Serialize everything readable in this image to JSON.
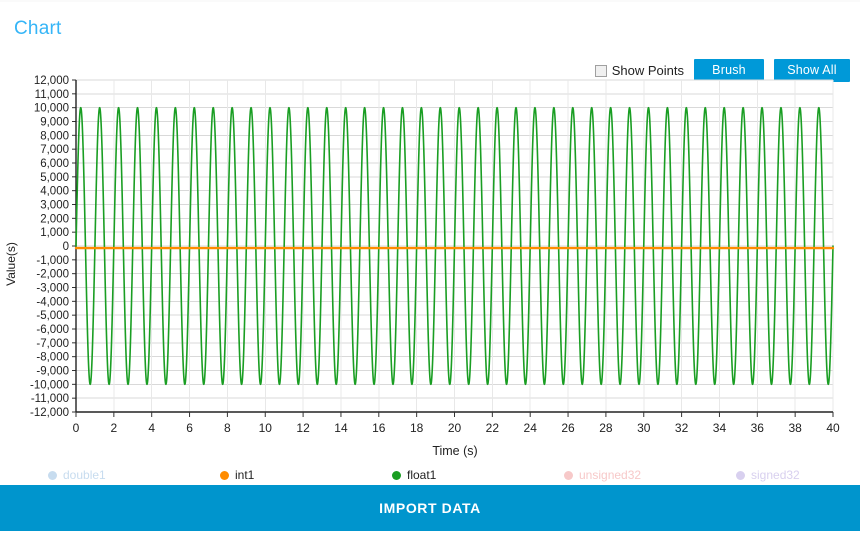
{
  "header": {
    "title": "Chart"
  },
  "toolbar": {
    "show_points_label": "Show Points",
    "show_points_checked": false,
    "brush_label": "Brush",
    "show_all_label": "Show All",
    "accent_color": "#0099d8"
  },
  "footer": {
    "import_label": "IMPORT DATA",
    "import_color": "#0095cd"
  },
  "legend": [
    {
      "label": "double1",
      "color": "#c7dcef",
      "active": false
    },
    {
      "label": "int1",
      "color": "#ff8c00",
      "active": true
    },
    {
      "label": "float1",
      "color": "#1a9e23",
      "active": true
    },
    {
      "label": "unsigned32",
      "color": "#f7c9c9",
      "active": false
    },
    {
      "label": "signed32",
      "color": "#d8d0ef",
      "active": false
    }
  ],
  "chart_data": {
    "type": "line",
    "title": "",
    "xlabel": "Time (s)",
    "ylabel": "Value(s)",
    "xlim": [
      0,
      40
    ],
    "ylim": [
      -12000,
      12000
    ],
    "xticks": [
      0,
      2,
      4,
      6,
      8,
      10,
      12,
      14,
      16,
      18,
      20,
      22,
      24,
      26,
      28,
      30,
      32,
      34,
      36,
      38,
      40
    ],
    "yticks": [
      12000,
      11000,
      10000,
      9000,
      8000,
      7000,
      6000,
      5000,
      4000,
      3000,
      2000,
      1000,
      0,
      -1000,
      -2000,
      -3000,
      -4000,
      -5000,
      -6000,
      -7000,
      -8000,
      -9000,
      -10000,
      -11000,
      -12000
    ],
    "ytick_labels": [
      "12,000",
      "11,000",
      "10,000",
      "9,000",
      "8,000",
      "7,000",
      "6,000",
      "5,000",
      "4,000",
      "3,000",
      "2,000",
      "1,000",
      "0",
      "-1,000",
      "-2,000",
      "-3,000",
      "-4,000",
      "-5,000",
      "-6,000",
      "-7,000",
      "-8,000",
      "-9,000",
      "-10,000",
      "-11,000",
      "-12,000"
    ],
    "grid": true,
    "grid_color": "#d9d9d9",
    "legend_position": "bottom",
    "series": [
      {
        "name": "float1",
        "color": "#1a9e23",
        "visible": true,
        "waveform": "sine",
        "amplitude": 10000,
        "offset": 0,
        "period_s": 1.0,
        "phase": 0,
        "description": "Sine wave oscillating between -10,000 and +10,000 with a 1 second period across 0-40 s"
      },
      {
        "name": "int1",
        "color": "#ff8c00",
        "visible": true,
        "waveform": "constant",
        "amplitude": 0,
        "offset": -150,
        "period_s": 0,
        "phase": 0,
        "description": "Near-constant flat line at approximately -150 across 0-40 s"
      },
      {
        "name": "double1",
        "color": "#c7dcef",
        "visible": false,
        "waveform": "none",
        "amplitude": 0,
        "offset": 0,
        "period_s": 0,
        "phase": 0,
        "description": "Hidden series"
      },
      {
        "name": "unsigned32",
        "color": "#f7c9c9",
        "visible": false,
        "waveform": "none",
        "amplitude": 0,
        "offset": 0,
        "period_s": 0,
        "phase": 0,
        "description": "Hidden series"
      },
      {
        "name": "signed32",
        "color": "#d8d0ef",
        "visible": false,
        "waveform": "none",
        "amplitude": 0,
        "offset": 0,
        "period_s": 0,
        "phase": 0,
        "description": "Hidden series"
      }
    ]
  }
}
